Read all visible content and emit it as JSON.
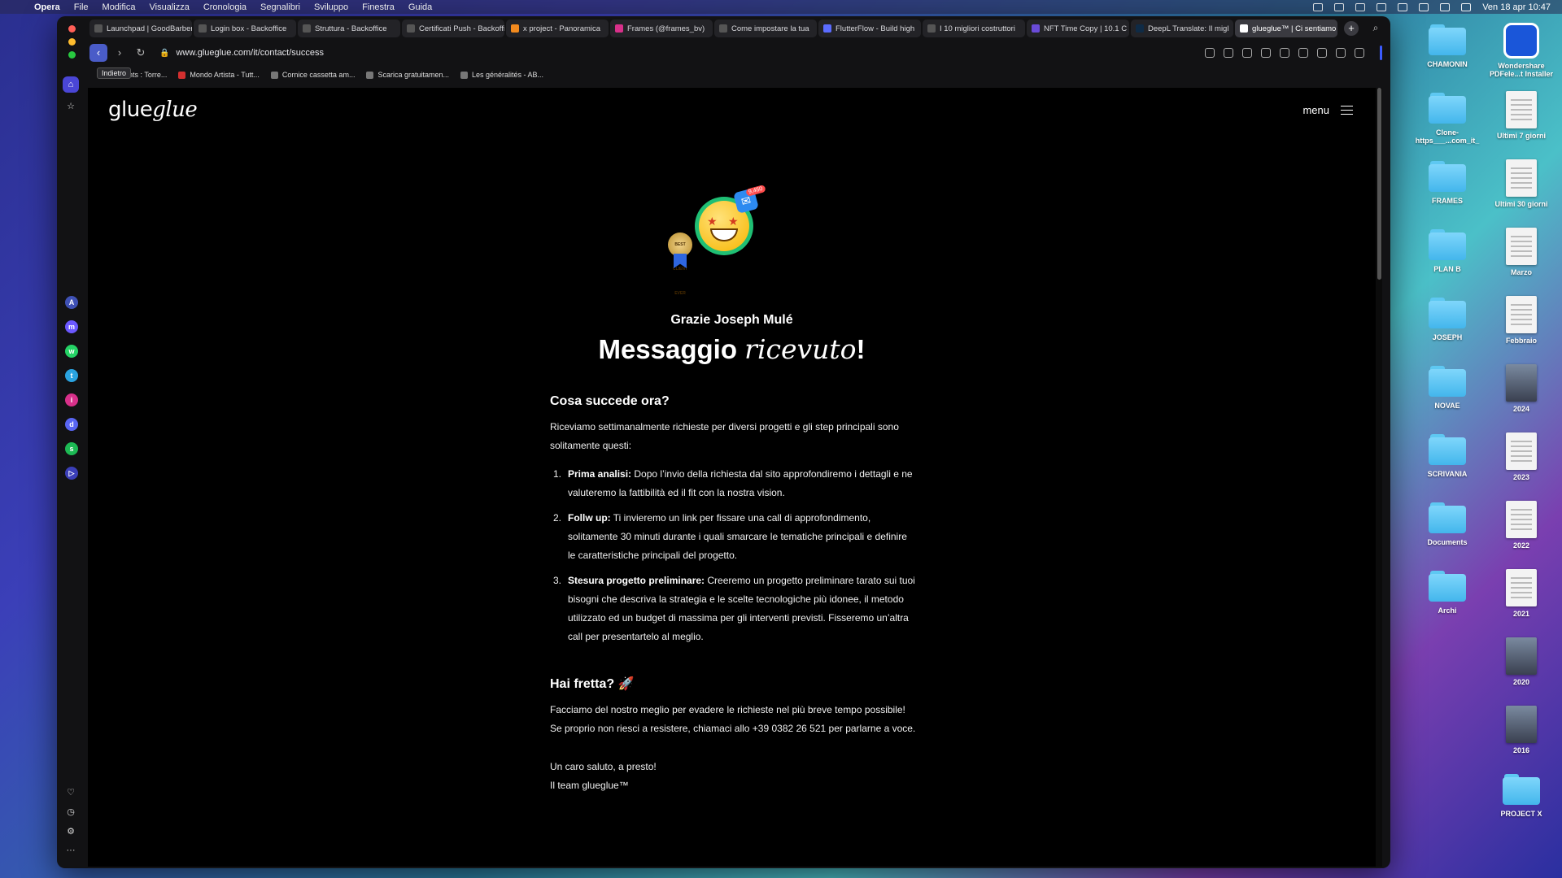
{
  "menubar": {
    "app": "Opera",
    "items": [
      "File",
      "Modifica",
      "Visualizza",
      "Cronologia",
      "Segnalibri",
      "Sviluppo",
      "Finestra",
      "Guida"
    ],
    "datetime": "Ven 18 apr  10:47"
  },
  "desktop": {
    "col1": [
      "CHAMONIN",
      "Clone-https___...com_it_",
      "FRAMES",
      "PLAN B",
      "JOSEPH",
      "NOVAE",
      "SCRIVANIA",
      "Documents",
      "Archi"
    ],
    "col2": [
      "Wondershare PDFele...t Installer",
      "Ultimi 7 giorni",
      "Ultimi 30 giorni",
      "Marzo",
      "Febbraio",
      "2024",
      "2023",
      "2022",
      "2021",
      "2020",
      "2016",
      "PROJECT X"
    ]
  },
  "browser": {
    "tabs": [
      "Launchpad | GoodBarber",
      "Login box - Backoffice",
      "Struttura - Backoffice",
      "Certificati Push - Backoffice",
      "x project - Panoramica",
      "Frames (@frames_bv)",
      "Come impostare la tua ",
      "FlutterFlow - Build high",
      "I 10 migliori costruttori",
      "NFT Time Copy | 10.1 C",
      "DeepL Translate: Il migl",
      "glueglue™ | Ci sentiamo"
    ],
    "url": "www.glueglue.com/it/contact/success",
    "back_tooltip": "Indietro",
    "bookmarks": [
      "rents : Torre...",
      "Mondo Artista - Tutt...",
      "Cornice cassetta am...",
      "Scarica gratuitamen...",
      "Les généralités - AB..."
    ]
  },
  "page": {
    "logo_plain": "glue",
    "logo_italic": "glue",
    "menu_label": "menu",
    "mail_count": "9,450",
    "badge_text": "BEST CLIENT EVER",
    "thanks": "Grazie Joseph Mulé",
    "headline_a": "Messaggio ",
    "headline_em": "ricevuto",
    "headline_b": "!",
    "section1_title": "Cosa succede ora?",
    "section1_intro": "Riceviamo settimanalmente richieste per diversi progetti e gli step principali sono solitamente questi:",
    "steps": [
      {
        "num": "1.",
        "title": "Prima analisi:",
        "text": " Dopo l’invio della richiesta dal sito approfondiremo i dettagli e ne valuteremo la fattibilità ed il fit con la nostra vision."
      },
      {
        "num": "2.",
        "title": "Follw up:",
        "text": " Ti invieremo un link per fissare una call di approfondimento, solitamente 30 minuti durante i quali smarcare le tematiche principali e definire le caratteristiche principali del progetto."
      },
      {
        "num": "3.",
        "title": "Stesura progetto preliminare:",
        "text": " Creeremo un progetto preliminare tarato sui tuoi bisogni che descriva la strategia e le scelte tecnologiche più idonee, il metodo utilizzato ed un budget di massima per gli interventi previsti. Fisseremo un’altra call per presentartelo al meglio."
      }
    ],
    "section2_title": "Hai fretta? 🚀",
    "section2_text": "Facciamo del nostro meglio per evadere le richieste nel più breve tempo possibile! Se proprio non riesci a resistere, chiamaci allo +39 0382 26 521 per parlarne a voce.",
    "signoff_1": "Un caro saluto, a presto!",
    "signoff_2": "Il team glueglue™"
  },
  "colors": {
    "accent": "#4a46d6",
    "page_bg": "#000000"
  }
}
